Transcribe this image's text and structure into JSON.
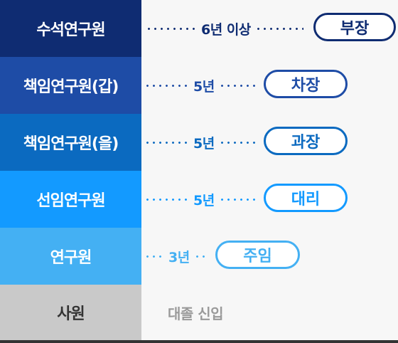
{
  "levels": [
    {
      "rank": "수석연구원",
      "years": "6년 이상",
      "position": "부장",
      "color": "#0f2c72"
    },
    {
      "rank": "책임연구원(갑)",
      "years": "5년",
      "position": "차장",
      "color": "#1e4ca6"
    },
    {
      "rank": "책임연구원(을)",
      "years": "5년",
      "position": "과장",
      "color": "#0b6ac0"
    },
    {
      "rank": "선임연구원",
      "years": "5년",
      "position": "대리",
      "color": "#139aff"
    },
    {
      "rank": "연구원",
      "years": "3년",
      "position": "주임",
      "color": "#44b0f3"
    },
    {
      "rank": "사원",
      "entry": "대졸 신입",
      "color": "#c9c9c9",
      "text_color": "#333333"
    }
  ]
}
